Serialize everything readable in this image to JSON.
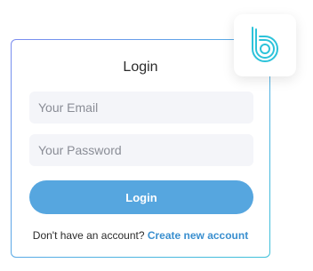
{
  "login_card": {
    "title": "Login",
    "email_placeholder": "Your Email",
    "password_placeholder": "Your Password",
    "login_button_label": "Login",
    "signup_prompt": "Don't have an account?",
    "signup_link_label": "Create new account"
  },
  "brand": {
    "logo_icon": "b-logo-icon",
    "accent_color": "#56a6df",
    "link_color": "#3a8fcf",
    "logo_color": "#2cc3da"
  }
}
